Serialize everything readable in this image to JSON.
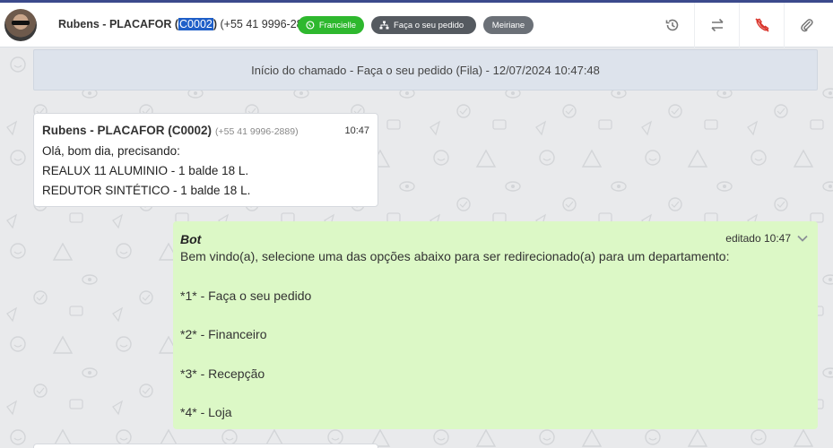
{
  "header": {
    "contact_name_prefix": "Rubens - PLACAFOR (",
    "contact_code": "C0002",
    "contact_name_suffix": ")",
    "contact_phone": " (+55 41 9996-2889)",
    "tags": {
      "whatsapp": "Francielle",
      "queue": "Faça o seu pedido",
      "agent": "Meiriane"
    },
    "actions": [
      "history-icon",
      "transfer-icon",
      "end-call-icon",
      "attach-icon"
    ],
    "colors": {
      "green_tag": "#2eb82e",
      "dark_tag": "#555a60",
      "gray_tag": "#6b7077",
      "selection": "#1f5fc8",
      "end_call": "#d9342b"
    }
  },
  "chat": {
    "system_banner": "Início do chamado - Faça o seu pedido (Fila) - 12/07/2024 10:47:48",
    "incoming": {
      "sender": "Rubens - PLACAFOR (C0002)",
      "phone": "(+55 41 9996-2889)",
      "time": "10:47",
      "lines": [
        "Olá, bom dia, precisando:",
        "REALUX 11 ALUMINIO - 1 balde 18 L.",
        "REDUTOR SINTÉTICO  -  1 balde 18 L."
      ]
    },
    "outgoing": {
      "sender": "Bot",
      "meta": "editado 10:47",
      "text": "Bem vindo(a), selecione uma das opções abaixo para ser redirecionado(a) para um departamento:\n\n*1* - Faça o seu pedido\n\n*2* - Financeiro\n\n*3* - Recepção\n\n*4* - Loja"
    },
    "colors": {
      "outgoing_bg": "#dcf8c6",
      "incoming_bg": "#ffffff",
      "banner_bg": "#dde3ec"
    }
  }
}
